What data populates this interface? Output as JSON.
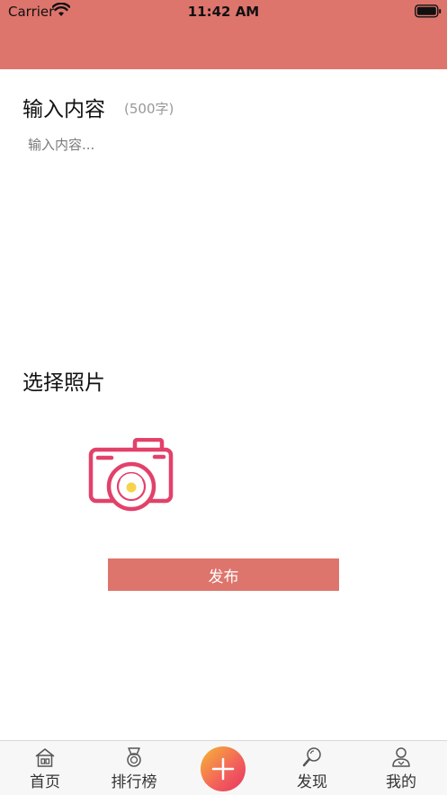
{
  "status_bar": {
    "carrier": "Carrier",
    "time": "11:42 AM"
  },
  "colors": {
    "header": "#dd756c",
    "accent": "#dd756c",
    "camera": "#e2416a",
    "camera_lens_center": "#f7d34a"
  },
  "compose": {
    "title": "输入内容",
    "limit": "(500字)",
    "placeholder": "输入内容..."
  },
  "photos": {
    "title": "选择照片",
    "add_photo_icon": "camera-icon"
  },
  "publish": {
    "label": "发布"
  },
  "tab_bar": {
    "items": [
      {
        "label": "首页",
        "icon": "home-icon"
      },
      {
        "label": "排行榜",
        "icon": "medal-icon"
      },
      {
        "label": "",
        "icon": "plus-icon"
      },
      {
        "label": "发现",
        "icon": "search-icon"
      },
      {
        "label": "我的",
        "icon": "user-icon"
      }
    ]
  }
}
